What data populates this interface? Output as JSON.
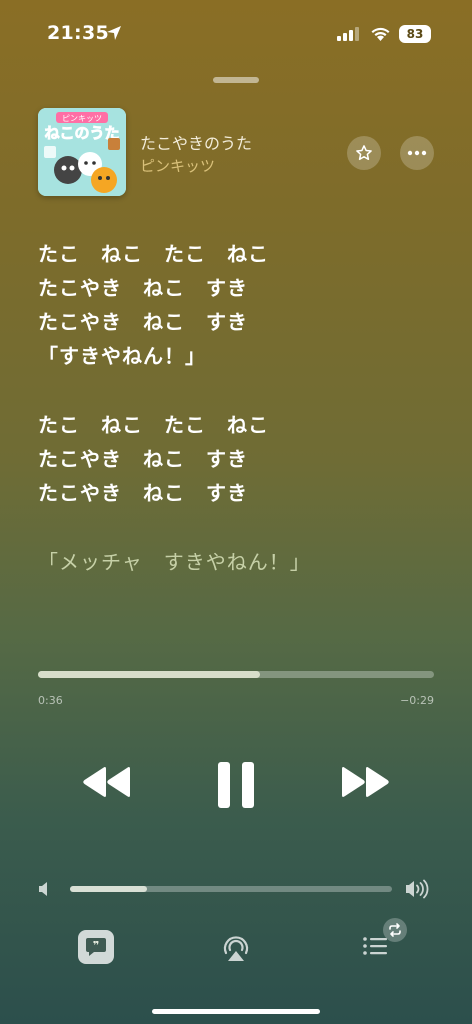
{
  "status_bar": {
    "time": "21:35",
    "battery": "83",
    "icons": [
      "location-arrow-icon",
      "cellular-signal-icon",
      "wifi-icon",
      "battery-icon"
    ]
  },
  "now_playing": {
    "song_title": "たこやきのうた",
    "artist": "ピンキッツ",
    "artwork": {
      "icon": "album-artwork",
      "banner_text": "ピンキッツ",
      "title_text": "ねこのうた"
    },
    "actions": [
      "star-icon",
      "more-icon"
    ]
  },
  "lyrics": [
    {
      "text": "たこ　ねこ　たこ　ねこ",
      "active": true
    },
    {
      "text": "たこやき　ねこ　すき",
      "active": true
    },
    {
      "text": "たこやき　ねこ　すき",
      "active": true
    },
    {
      "text": "「すきやねん！」",
      "active": true
    },
    {
      "text": "たこ　ねこ　たこ　ねこ",
      "active": true
    },
    {
      "text": "たこやき　ねこ　すき",
      "active": true
    },
    {
      "text": "たこやき　ねこ　すき",
      "active": true
    },
    {
      "text": "「メッチャ　すきやねん！」",
      "active": false
    }
  ],
  "playback": {
    "elapsed": "0:36",
    "remaining": "−0:29",
    "progress_fraction": 0.56,
    "state": "playing",
    "controls": [
      "rewind-icon",
      "pause-icon",
      "fast-forward-icon"
    ]
  },
  "volume": {
    "level_fraction": 0.24,
    "icons": [
      "speaker-low-icon",
      "speaker-high-icon"
    ]
  },
  "bottom_bar": {
    "buttons": [
      "lyrics-icon",
      "airplay-icon",
      "queue-icon"
    ],
    "repeat_badge": "repeat-icon"
  },
  "colors": {
    "background_top": "#8a6e25",
    "background_bottom": "#2c4f4c",
    "artist_accent": "#d9c07a"
  }
}
